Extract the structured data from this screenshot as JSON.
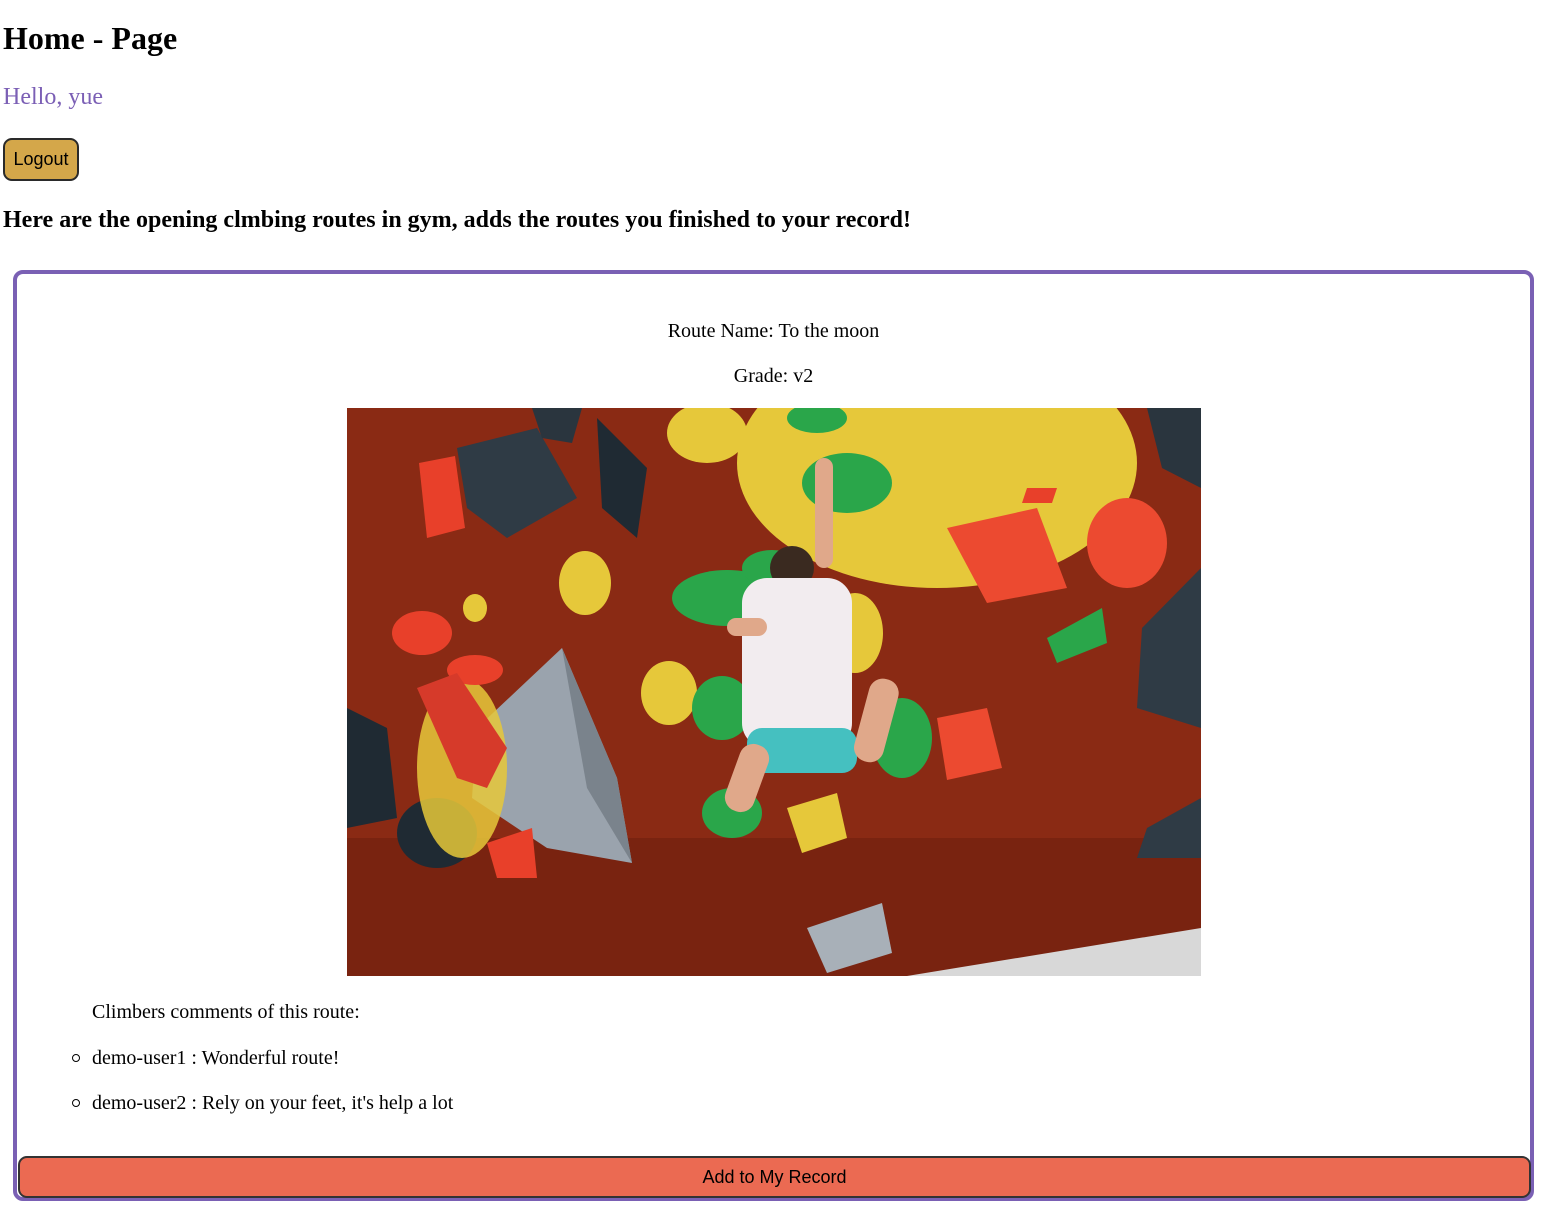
{
  "page": {
    "title": "Home - Page",
    "greeting": "Hello, yue",
    "logout_label": "Logout",
    "intro": "Here are the opening clmbing routes in gym, adds the routes you finished to your record!"
  },
  "route": {
    "name": "Route Name: To the moon",
    "grade": "Grade: v2",
    "photo_alt": "climbing-wall-photo",
    "comments_heading": "Climbers comments of this route:",
    "comments": [
      "demo-user1 : Wonderful route!",
      "demo-user2 : Rely on your feet, it's help a lot"
    ],
    "add_label": "Add to My Record"
  },
  "colors": {
    "greeting": "#7b5fb5",
    "logout_bg": "#d4a74a",
    "card_border": "#7a60b4",
    "add_button_bg": "#eb6a52",
    "wall": "#8a2a14",
    "hold_yellow": "#e6c83a",
    "hold_green": "#2aa64a",
    "hold_red": "#e8402a"
  }
}
